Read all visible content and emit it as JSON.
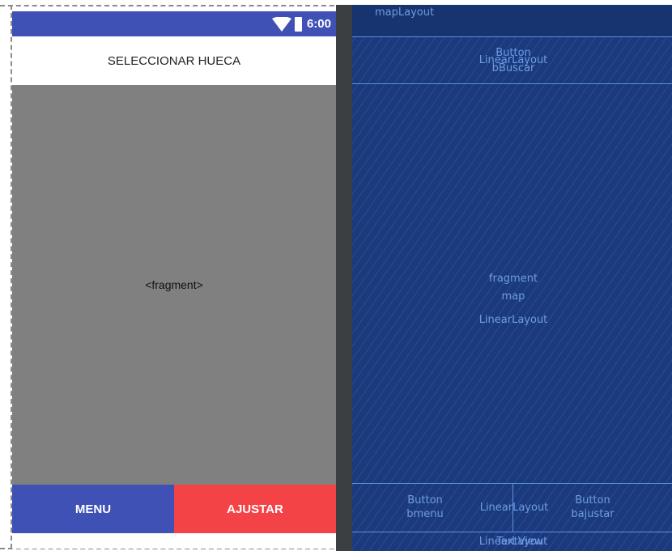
{
  "status_bar": {
    "time": "6:00"
  },
  "app": {
    "title": "SELECCIONAR HUECA",
    "fragment_placeholder": "<fragment>",
    "menu_label": "MENU",
    "ajustar_label": "AJUSTAR"
  },
  "blueprint": {
    "root_label": "mapLayout",
    "top_button_type": "Button",
    "top_layout_label": "LinearLayout",
    "top_button_id": "bBuscar",
    "fragment_type": "fragment",
    "fragment_id": "map",
    "fragment_layout": "LinearLayout",
    "menu_button_type": "Button",
    "menu_button_id": "bmenu",
    "bottom_layout_label": "LinearLayout",
    "ajustar_button_type": "Button",
    "ajustar_button_id": "bajustar",
    "footer_label_1": "LinearLayout",
    "footer_label_2": "TextView"
  },
  "colors": {
    "primary": "#3f51b5",
    "accent": "#f44346",
    "fragment_bg": "#808080",
    "blueprint_bg": "#1b3a7e"
  },
  "icons": [
    "wifi-icon",
    "battery-icon"
  ]
}
